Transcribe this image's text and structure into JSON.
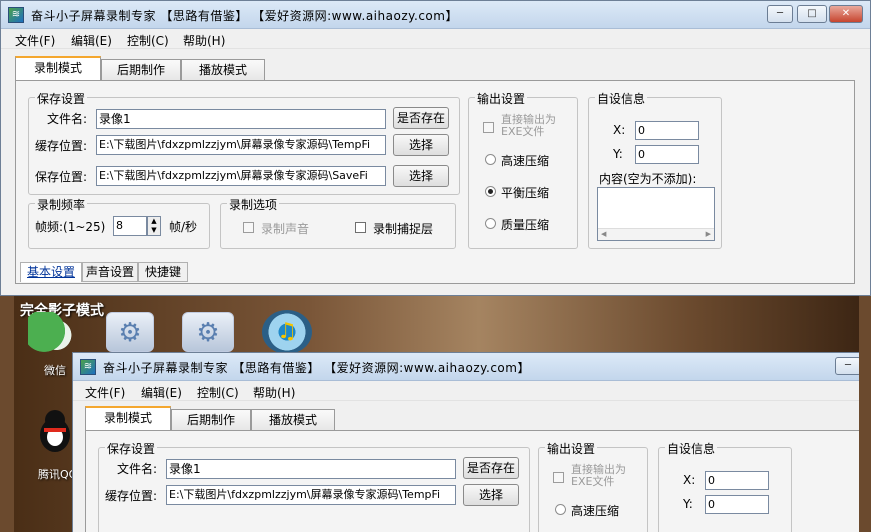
{
  "window": {
    "title": "奋斗小子屏幕录制专家 【思路有借鉴】 【爱好资源网:www.aihaozy.com】",
    "min": "─",
    "max": "□",
    "close": "✕"
  },
  "menu": [
    "文件(F)",
    "编辑(E)",
    "控制(C)",
    "帮助(H)"
  ],
  "tabs": [
    "录制模式",
    "后期制作",
    "播放模式"
  ],
  "save_settings": {
    "legend": "保存设置",
    "filename_label": "文件名:",
    "filename_value": "录像1",
    "exists_button": "是否存在",
    "cache_label": "缓存位置:",
    "cache_value": "E:\\下载图片\\fdxzpmlzzjym\\屏幕录像专家源码\\TempFi",
    "cache_button": "选择",
    "save_label": "保存位置:",
    "save_value": "E:\\下载图片\\fdxzpmlzzjym\\屏幕录像专家源码\\SaveFi",
    "save_button": "选择"
  },
  "frame_rate": {
    "legend": "录制频率",
    "label": "帧频:(1~25)",
    "value": "8",
    "unit": "帧/秒"
  },
  "record_options": {
    "legend": "录制选项",
    "audio": "录制声音",
    "layers": "录制捕捉层"
  },
  "output": {
    "legend": "输出设置",
    "exe": "直接输出为EXE文件",
    "high": "高速压缩",
    "balanced": "平衡压缩",
    "quality": "质量压缩",
    "selected": "balanced"
  },
  "custom": {
    "legend": "自设信息",
    "x_label": "X:",
    "x_value": "0",
    "y_label": "Y:",
    "y_value": "0",
    "content_label": "内容(空为不添加):"
  },
  "subtabs": [
    "基本设置",
    "声音设置",
    "快捷键"
  ],
  "preview": {
    "mode_label": "完全影子模式",
    "icons": [
      "微信",
      "腾讯QQ"
    ]
  }
}
